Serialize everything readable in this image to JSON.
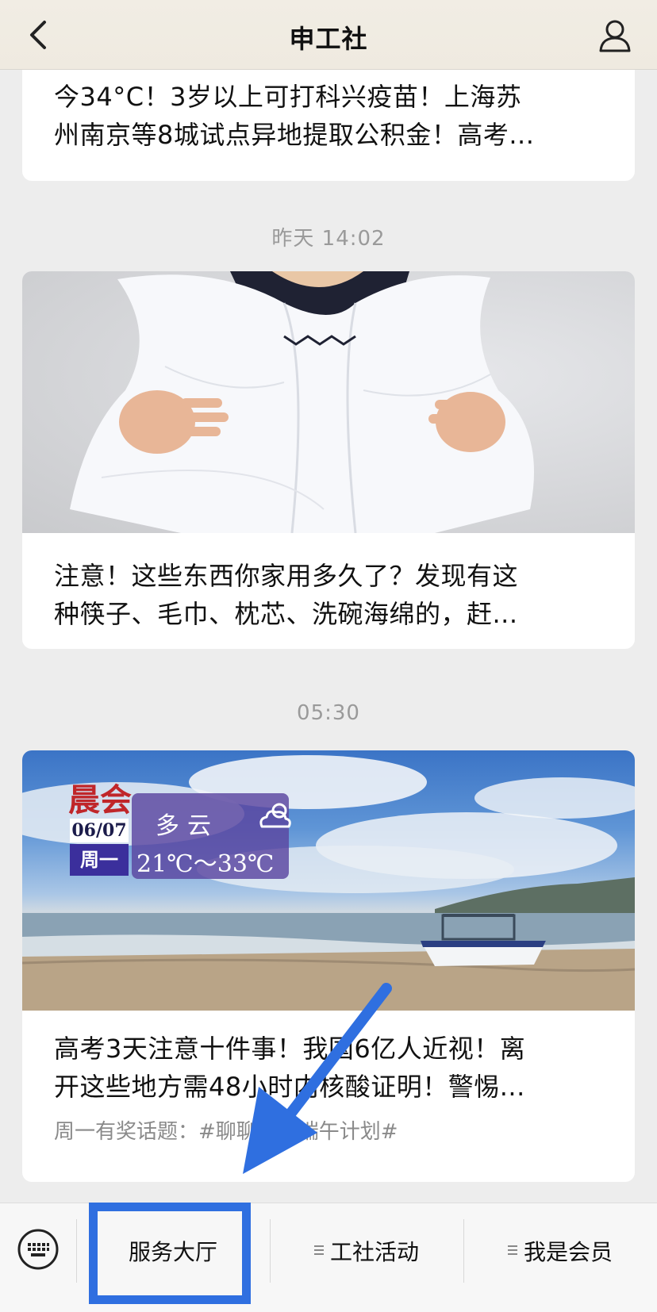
{
  "header": {
    "title": "申工社"
  },
  "feed": {
    "items": [
      {
        "title_lines": [
          "今34°C！3岁以上可打科兴疫苗！上海苏",
          "州南京等8城试点异地提取公积金！高考..."
        ]
      },
      {
        "timestamp": "昨天 14:02",
        "title_lines": [
          "注意！这些东西你家用多久了？发现有这",
          "种筷子、毛巾、枕芯、洗碗海绵的，赶..."
        ]
      },
      {
        "timestamp": "05:30",
        "weather": {
          "label": "晨会",
          "date": "06/07",
          "day": "周一",
          "condition": "多云",
          "temp": "21℃～33℃"
        },
        "title_lines": [
          "高考3天注意十件事！我国6亿人近视！离",
          "开这些地方需48小时内核酸证明！警惕..."
        ],
        "subtitle": "周一有奖话题：#聊聊你的端午计划#"
      }
    ]
  },
  "menu": {
    "items": [
      {
        "label": "服务大厅"
      },
      {
        "label": "工社活动"
      },
      {
        "label": "我是会员"
      }
    ]
  },
  "colors": {
    "highlight": "#2f6fe0",
    "background": "#ededed"
  }
}
